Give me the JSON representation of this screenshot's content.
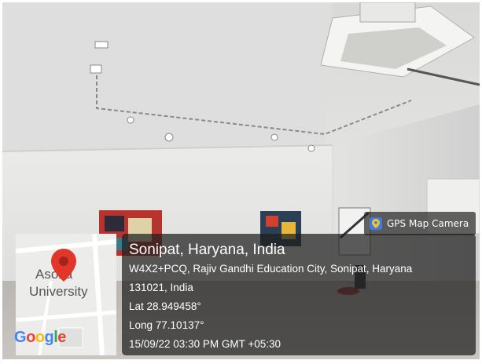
{
  "badge": {
    "label": "GPS Map Camera",
    "icon": "gps-map-camera-icon"
  },
  "map": {
    "place_line1": "Asoka",
    "place_line2": "University",
    "provider": "Google",
    "pin_color": "#e1372b"
  },
  "location": {
    "title": "Sonipat, Haryana, India",
    "address_line1": "W4X2+PCQ, Rajiv Gandhi Education City, Sonipat, Haryana",
    "address_line2": "131021, India",
    "lat": "Lat 28.949458°",
    "long": "Long 77.10137°",
    "datetime": "15/09/22 03:30 PM GMT +05:30"
  }
}
